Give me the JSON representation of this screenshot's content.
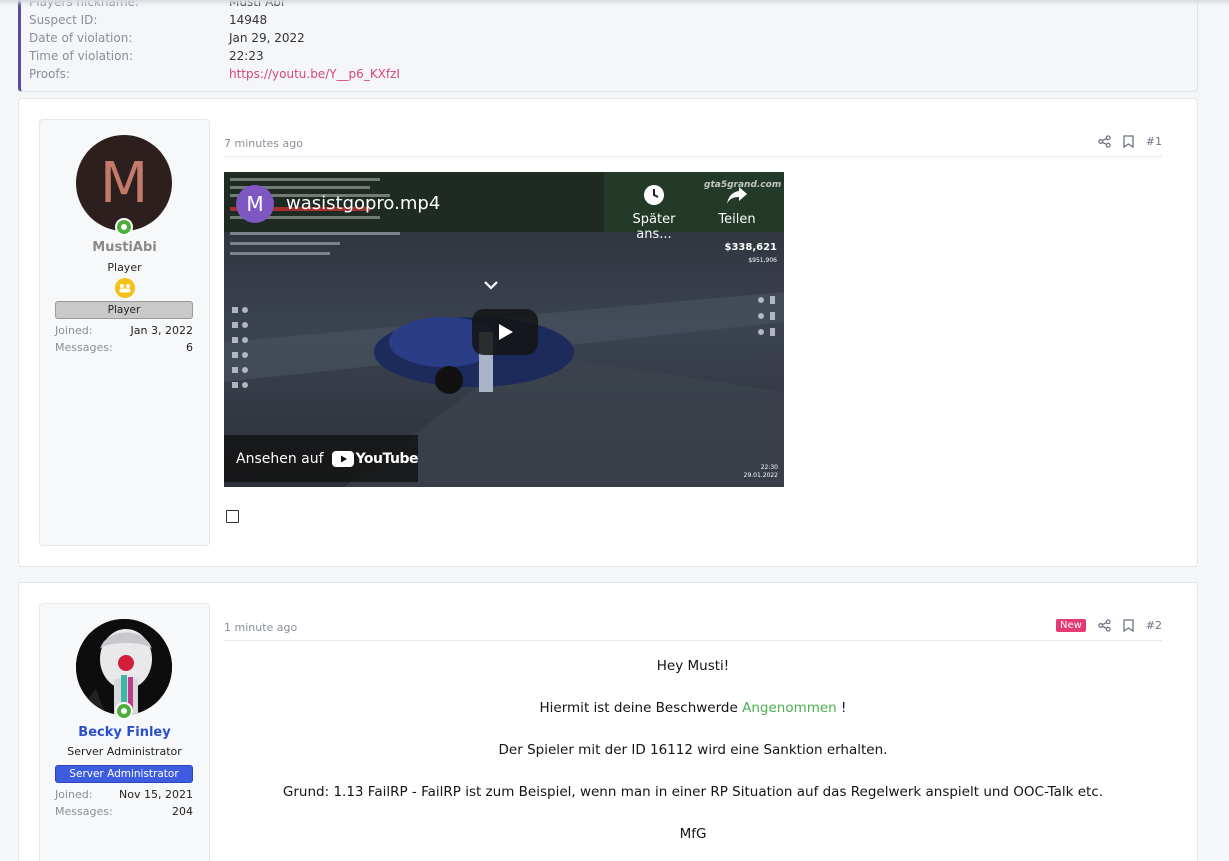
{
  "details": {
    "rows": [
      {
        "label": "Players nickname:",
        "value": "Musti Abi"
      },
      {
        "label": "Suspect ID:",
        "value": "14948"
      },
      {
        "label": "Date of violation:",
        "value": "Jan 29, 2022"
      },
      {
        "label": "Time of violation:",
        "value": "22:23"
      },
      {
        "label": "Proofs:",
        "value": "https://youtu.be/Y__p6_KXfzI"
      }
    ]
  },
  "posts": [
    {
      "user": {
        "avatar_letter": "M",
        "name": "MustiAbi",
        "title": "Player",
        "banner": "Player",
        "stats": [
          {
            "label": "Joined:",
            "value": "Jan 3, 2022"
          },
          {
            "label": "Messages:",
            "value": "6"
          }
        ]
      },
      "time": "7 minutes ago",
      "number": "#1",
      "video": {
        "channel_letter": "M",
        "title": "wasistgopro.mp4",
        "watch_later": "Später ans...",
        "share": "Teilen",
        "watch_on": "Ansehen auf",
        "youtube": "YouTube",
        "money": "$338,621",
        "bank": "$951,906",
        "clock": "22:30",
        "date": "29.01.2022",
        "server": "gta5grand.com"
      }
    },
    {
      "user": {
        "name": "Becky Finley",
        "title": "Server Administrator",
        "banner": "Server Administrator",
        "stats": [
          {
            "label": "Joined:",
            "value": "Nov 15, 2021"
          },
          {
            "label": "Messages:",
            "value": "204"
          }
        ]
      },
      "time": "1 minute ago",
      "new_badge": "New",
      "number": "#2",
      "body": {
        "greeting": "Hey Musti!",
        "line1_pre": "Hiermit ist deine Beschwerde",
        "line1_status": "Angenommen",
        "line1_post": "!",
        "line2": "Der Spieler mit der ID 16112 wird eine Sanktion erhalten.",
        "line3": "Grund: 1.13 FailRP - FailRP ist zum Beispiel, wenn man in einer RP Situation auf das Regelwerk anspielt und OOC-Talk etc.",
        "signoff": "MfG"
      }
    }
  ],
  "colors": {
    "accent": "#5b4b9e",
    "link": "#d8467c",
    "accepted": "#4caf50",
    "new_badge": "#e63a76",
    "admin_banner": "#3d5ce0",
    "admin_name": "#2a4fc7",
    "online": "#4caf3c"
  },
  "icons": [
    "share-icon",
    "bookmark-icon",
    "online-status-icon",
    "player-rank-icon",
    "play-icon",
    "clock-icon",
    "share-arrow-icon"
  ]
}
